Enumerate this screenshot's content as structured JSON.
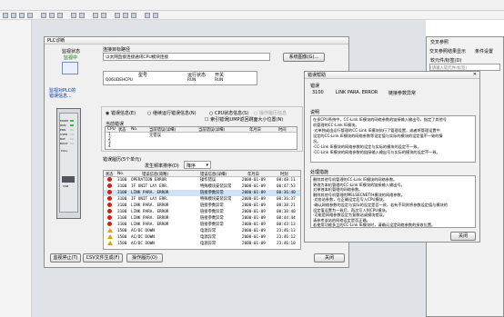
{
  "main_title": "PLC诊断",
  "monitor": {
    "label": "监视状态",
    "status": "监视中",
    "stop_button": "监视停止(T)"
  },
  "route": {
    "label": "连接目标路径",
    "value": "以太网直接连接通讯CPU模块连接",
    "button": "系统图像(G)..."
  },
  "module_table": {
    "headers": [
      "型号",
      "运行状态",
      "开关"
    ],
    "model": "Q06UDEHCPU",
    "run": "RUN",
    "switch": "RUN"
  },
  "left_notes": {
    "line1": "监视对PLC的",
    "line2": "错误信息..."
  },
  "current_error": {
    "label": "当前错误",
    "radio_error": "错误信息(E)",
    "radio_continue": "继续运行错误信息(N)",
    "radio_cpu": "CPU状态信息(S)",
    "radio_operation": "操作履历信息",
    "checkbox": "索引错误JUMP返回跳面大小位置(N)",
    "headers": [
      "CPU",
      "状态",
      "No.",
      "当前错误(详细)",
      "当前错误(详细)",
      "年月日",
      "时间"
    ],
    "rows": [
      [
        "1",
        "",
        "",
        "无错误",
        "",
        "",
        ""
      ],
      [
        "2",
        "",
        "",
        "",
        "",
        "",
        ""
      ],
      [
        "3",
        "",
        "",
        "",
        "",
        "",
        ""
      ],
      [
        "4",
        "",
        "",
        "",
        "",
        "",
        ""
      ]
    ]
  },
  "history": {
    "title": "错误履历(5个单元)",
    "filter_label": "发生频率排序(D)",
    "filter_value": "降序",
    "headers": [
      "状态",
      "No.",
      "错误信息(简略)",
      "错误信息(详细)",
      "年月日",
      "时刻"
    ],
    "rows": [
      {
        "icon": "err",
        "no": "3100",
        "short": "OPERATION ERROR",
        "detail": "操作错误",
        "date": "2000-01-09",
        "time": "00:48:11"
      },
      {
        "icon": "err",
        "no": "3100",
        "short": "IF UNIT LAY ERR.",
        "detail": "特殊模块安装异常",
        "date": "2000-01-09",
        "time": "00:47:53"
      },
      {
        "icon": "err",
        "no": "3100",
        "short": "LINK PARA. ERROR",
        "detail": "链接参数异常",
        "date": "2000-01-09",
        "time": "00:36:40"
      },
      {
        "icon": "err",
        "no": "3100",
        "short": "IF UNIT LAY ERR.",
        "detail": "特殊模块安装异常",
        "date": "2000-01-09",
        "time": "00:36:37"
      },
      {
        "icon": "err",
        "no": "3100",
        "short": "LINK PARA. ERROR",
        "detail": "链接参数异常",
        "date": "2000-01-09",
        "time": "00:38:21"
      },
      {
        "icon": "err",
        "no": "3100",
        "short": "LINK PARA. ERROR",
        "detail": "链接参数异常",
        "date": "2000-01-09",
        "time": "00:10:40"
      },
      {
        "icon": "err",
        "no": "3100",
        "short": "LINK PARA. ERROR",
        "detail": "链接参数异常",
        "date": "2000-01-09",
        "time": "00:44:44"
      },
      {
        "icon": "err",
        "no": "3100",
        "short": "LINK PARA. ERROR",
        "detail": "链接参数异常",
        "date": "2000-01-09",
        "time": "00:43:13"
      },
      {
        "icon": "warn",
        "no": "1500",
        "short": "AC/DC DOWN",
        "detail": "电源异常",
        "date": "2000-01-09",
        "time": "23:46:13"
      },
      {
        "icon": "warn",
        "no": "1500",
        "short": "AC/DC DOWN",
        "detail": "电源异常",
        "date": "2000-01-09",
        "time": "23:46:12"
      },
      {
        "icon": "warn",
        "no": "1500",
        "short": "AC/DC DOWN",
        "detail": "电源异常",
        "date": "2000-01-09",
        "time": "23:46:10"
      }
    ]
  },
  "bottom_buttons": {
    "csv": "CSV文件生成(F)",
    "history": "操作履历(O)",
    "close": "关闭"
  },
  "help": {
    "title": "错误帮助",
    "error_label": "错误",
    "code": "3100",
    "short": "LINK PARA. ERROR",
    "detail": "链接参数异常",
    "desc_label": "说明",
    "desc": [
      "在多CPU系统中，CC-Link IE模块的网络参数的链接输入输出号，指定了其他号",
      "机管理的CC-Link IE模块。",
      "·对单独或由运行管理的CC-Link IE模块执行了管理设置，或者将管理设置中",
      "设定的CC-Link IE模块的网络参数等设定值与实际的模块的设定值不一致的情",
      "况。",
      "·CC-Link IE模块的网络参数的设定与实际的模块的设定不一致。",
      "·CC-Link IE模块的网络参数的链接输入输出号与实际的模块的设定不一致。"
    ],
    "fix_label": "处理措施",
    "fix": [
      "删除其他号机管理的CC-Link IE模块的网络参数。",
      "更改为本机管理的CC-Link IE模块的链接输入输出号。",
      "对单独本机管理的网络参数。",
      "删除其他号机管理的MELSECNET/H模块的网络参数。",
      "·对各站参数，在正确设定后写入CPU模块。",
      "·确认网络参数的设定与实际的设定是否一致，若有不同则将参数设定值与模块的",
      "设定值设置为一致后，再次写入到CPU模块。",
      "·可能是网络参数设定为复数站或模块错误。",
      "请参考该站的网络设定是否正确。",
      "若使用功能多工的CC-Link IE模块时，请确认设定网络参数的接收位置。"
    ],
    "close": "关闭"
  },
  "right_panel": {
    "tab1": "交叉参照",
    "tab2": "交叉参照结果显示",
    "tab3": "条件设置",
    "field_label": "软元件/标签(D)",
    "hint": "(请输入软元件/标签)"
  },
  "cpu": {
    "leds": [
      "MODE",
      "RUN",
      "ERR.",
      "USER",
      "BAT.",
      "BOOT"
    ],
    "mode": "PULL",
    "usb": "USB"
  }
}
